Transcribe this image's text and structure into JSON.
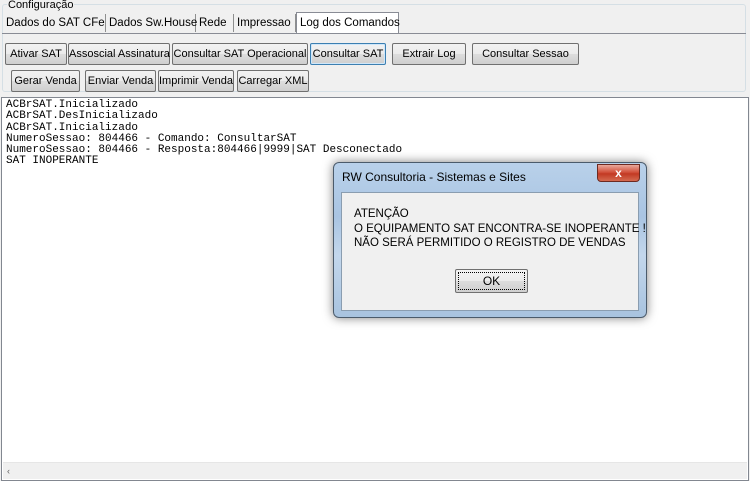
{
  "config_group": {
    "label": "Configuração"
  },
  "tabs": [
    {
      "label": "Dados do SAT CFe"
    },
    {
      "label": "Dados Sw.House"
    },
    {
      "label": "Rede"
    },
    {
      "label": "Impressao"
    },
    {
      "label": "Log dos Comandos",
      "active": true
    }
  ],
  "toolbar": {
    "row1": [
      {
        "label": "Ativar SAT"
      },
      {
        "label": "Assoscial Assinatura"
      },
      {
        "label": "Consultar SAT Operacional"
      },
      {
        "label": "Consultar SAT"
      },
      {
        "label": "Extrair Log"
      },
      {
        "label": "Consultar Sessao"
      }
    ],
    "row2": [
      {
        "label": "Gerar Venda"
      },
      {
        "label": "Enviar Venda"
      },
      {
        "label": "Imprimir Venda"
      },
      {
        "label": "Carregar XML"
      }
    ]
  },
  "log": {
    "lines": [
      "ACBrSAT.Inicializado",
      "ACBrSAT.DesInicializado",
      "ACBrSAT.Inicializado",
      "NumeroSessao: 804466 - Comando: ConsultarSAT",
      "NumeroSessao: 804466 - Resposta:804466|9999|SAT Desconectado",
      "SAT INOPERANTE"
    ]
  },
  "dialog": {
    "title": "RW Consultoria - Sistemas e Sites",
    "close_symbol": "x",
    "message": [
      "ATENÇÃO",
      "O EQUIPAMENTO SAT ENCONTRA-SE INOPERANTE !",
      "NÃO SERÁ PERMITIDO O REGISTRO DE VENDAS"
    ],
    "ok_label": "OK"
  },
  "scrollbar": {
    "left_arrow": "‹"
  }
}
